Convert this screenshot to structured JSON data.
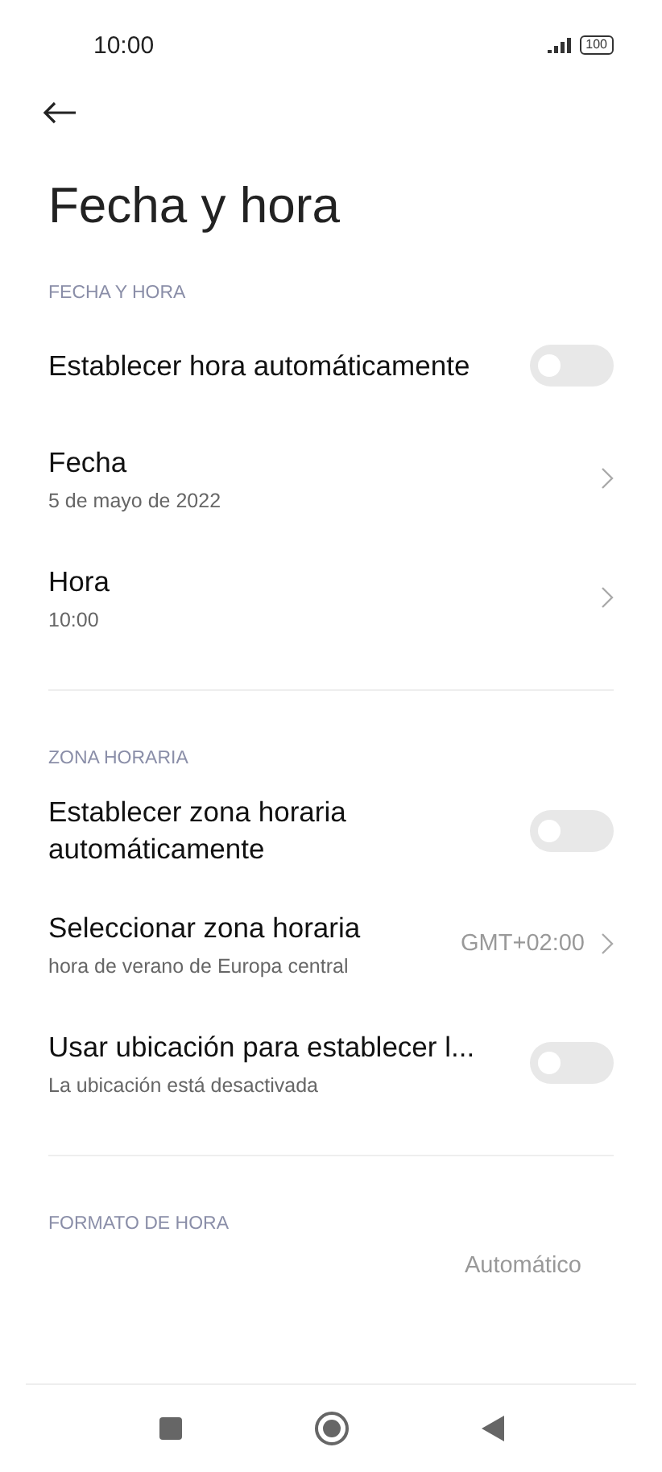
{
  "status_bar": {
    "time": "10:00",
    "battery": "100"
  },
  "title": "Fecha y hora",
  "sections": [
    {
      "header": "FECHA Y HORA",
      "items": [
        {
          "kind": "toggle",
          "title": "Establecer hora automáticamente",
          "on": false
        },
        {
          "kind": "link",
          "title": "Fecha",
          "subtitle": "5 de mayo de 2022"
        },
        {
          "kind": "link",
          "title": "Hora",
          "subtitle": "10:00"
        }
      ]
    },
    {
      "header": "ZONA HORARIA",
      "items": [
        {
          "kind": "toggle",
          "title": "Establecer zona horaria automáticamente",
          "on": false
        },
        {
          "kind": "link",
          "title": "Seleccionar zona horaria",
          "subtitle": "hora de verano de Europa central",
          "value": "GMT+02:00"
        },
        {
          "kind": "toggle",
          "title": "Usar ubicación para establecer l...",
          "subtitle": "La ubicación está desactivada",
          "on": false
        }
      ]
    },
    {
      "header": "FORMATO DE HORA",
      "items": [
        {
          "kind": "value",
          "value": "Automático"
        }
      ]
    }
  ]
}
